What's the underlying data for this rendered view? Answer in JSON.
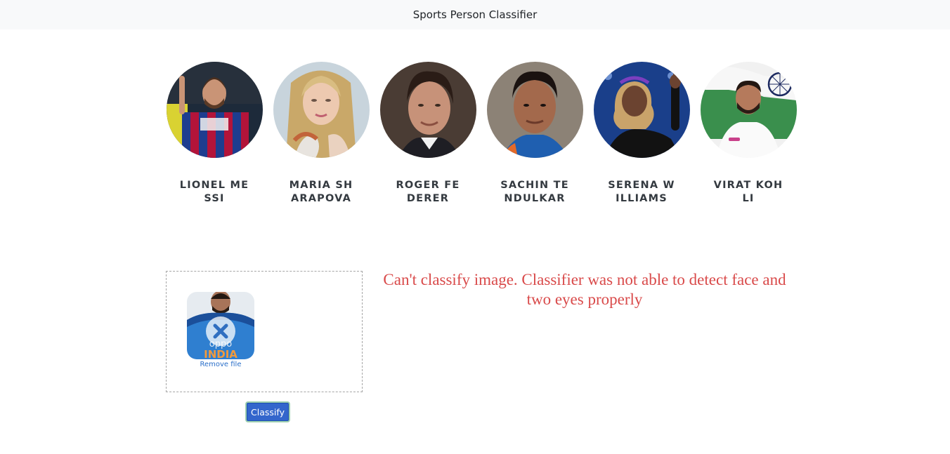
{
  "navbar": {
    "title": "Sports Person Classifier"
  },
  "players": [
    {
      "name": "LIONEL MESSI",
      "image_icon": "lionel-messi-photo"
    },
    {
      "name": "MARIA SHARAPOVA",
      "image_icon": "maria-sharapova-photo"
    },
    {
      "name": "ROGER FEDERER",
      "image_icon": "roger-federer-photo"
    },
    {
      "name": "SACHIN TENDULKAR",
      "image_icon": "sachin-tendulkar-photo"
    },
    {
      "name": "SERENA WILLIAMS",
      "image_icon": "serena-williams-photo"
    },
    {
      "name": "VIRAT KOHLI",
      "image_icon": "virat-kohli-photo"
    }
  ],
  "dropzone": {
    "remove_label": "Remove file",
    "preview_icon": "uploaded-image-thumbnail",
    "overlay_icon": "remove-x-icon"
  },
  "classify_button": {
    "label": "Classify"
  },
  "result": {
    "error": "Can't classify image. Classifier was not able to detect face and two eyes properly"
  },
  "colors": {
    "navbar_bg": "#f8f9fa",
    "button_bg": "#3366cc",
    "error_text": "#d94a4a",
    "link": "#2a6fc9"
  }
}
